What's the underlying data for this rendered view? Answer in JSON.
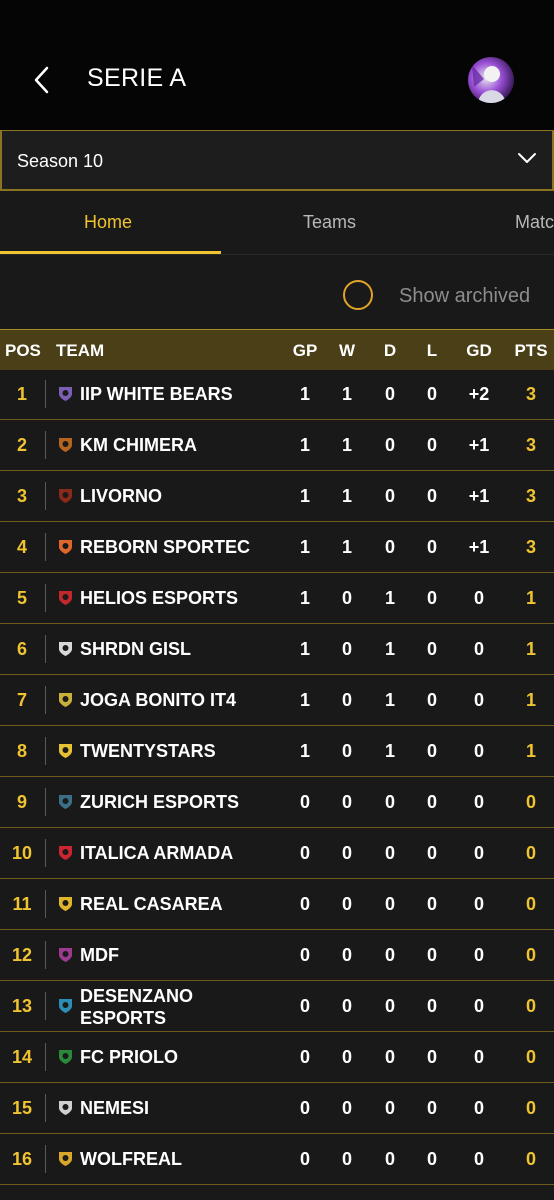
{
  "header": {
    "title": "SERIE A"
  },
  "season": {
    "selected": "Season 10"
  },
  "tabs": [
    {
      "label": "Home",
      "active": true
    },
    {
      "label": "Teams",
      "active": false
    },
    {
      "label": "Matc",
      "active": false
    }
  ],
  "archived": {
    "label": "Show archived",
    "checked": false
  },
  "table": {
    "columns": [
      "POS",
      "TEAM",
      "GP",
      "W",
      "D",
      "L",
      "GD",
      "PTS"
    ],
    "rows": [
      {
        "pos": "1",
        "team": "IIP WHITE BEARS",
        "gp": "1",
        "w": "1",
        "d": "0",
        "l": "0",
        "gd": "+2",
        "pts": "3",
        "logo_color": "#7b5fb4"
      },
      {
        "pos": "2",
        "team": "KM CHIMERA",
        "gp": "1",
        "w": "1",
        "d": "0",
        "l": "0",
        "gd": "+1",
        "pts": "3",
        "logo_color": "#b5651d"
      },
      {
        "pos": "3",
        "team": "LIVORNO",
        "gp": "1",
        "w": "1",
        "d": "0",
        "l": "0",
        "gd": "+1",
        "pts": "3",
        "logo_color": "#8b2a1a"
      },
      {
        "pos": "4",
        "team": "REBORN SPORTEC",
        "gp": "1",
        "w": "1",
        "d": "0",
        "l": "0",
        "gd": "+1",
        "pts": "3",
        "logo_color": "#e0672a"
      },
      {
        "pos": "5",
        "team": "HELIOS ESPORTS",
        "gp": "1",
        "w": "0",
        "d": "1",
        "l": "0",
        "gd": "0",
        "pts": "1",
        "logo_color": "#c0282b"
      },
      {
        "pos": "6",
        "team": "SHRDN GISL",
        "gp": "1",
        "w": "0",
        "d": "1",
        "l": "0",
        "gd": "0",
        "pts": "1",
        "logo_color": "#d8d8d8"
      },
      {
        "pos": "7",
        "team": "JOGA BONITO IT4",
        "gp": "1",
        "w": "0",
        "d": "1",
        "l": "0",
        "gd": "0",
        "pts": "1",
        "logo_color": "#c9b03a"
      },
      {
        "pos": "8",
        "team": "TWENTYSTARS",
        "gp": "1",
        "w": "0",
        "d": "1",
        "l": "0",
        "gd": "0",
        "pts": "1",
        "logo_color": "#e6c234"
      },
      {
        "pos": "9",
        "team": "ZURICH ESPORTS",
        "gp": "0",
        "w": "0",
        "d": "0",
        "l": "0",
        "gd": "0",
        "pts": "0",
        "logo_color": "#3b6f86"
      },
      {
        "pos": "10",
        "team": "ITALICA ARMADA",
        "gp": "0",
        "w": "0",
        "d": "0",
        "l": "0",
        "gd": "0",
        "pts": "0",
        "logo_color": "#cc2530"
      },
      {
        "pos": "11",
        "team": "REAL CASAREA",
        "gp": "0",
        "w": "0",
        "d": "0",
        "l": "0",
        "gd": "0",
        "pts": "0",
        "logo_color": "#e0b52a"
      },
      {
        "pos": "12",
        "team": "MDF",
        "gp": "0",
        "w": "0",
        "d": "0",
        "l": "0",
        "gd": "0",
        "pts": "0",
        "logo_color": "#9b3a8e"
      },
      {
        "pos": "13",
        "team": "DESENZANO ESPORTS",
        "gp": "0",
        "w": "0",
        "d": "0",
        "l": "0",
        "gd": "0",
        "pts": "0",
        "logo_color": "#2b8fb5"
      },
      {
        "pos": "14",
        "team": "FC PRIOLO",
        "gp": "0",
        "w": "0",
        "d": "0",
        "l": "0",
        "gd": "0",
        "pts": "0",
        "logo_color": "#2a8a3a"
      },
      {
        "pos": "15",
        "team": "NEMESI",
        "gp": "0",
        "w": "0",
        "d": "0",
        "l": "0",
        "gd": "0",
        "pts": "0",
        "logo_color": "#d0d0d0"
      },
      {
        "pos": "16",
        "team": "WOLFREAL",
        "gp": "0",
        "w": "0",
        "d": "0",
        "l": "0",
        "gd": "0",
        "pts": "0",
        "logo_color": "#d8a62a"
      }
    ]
  },
  "colors": {
    "accent": "#f0c330",
    "header_bg": "#4b3f17",
    "row_border": "#6f5d1d",
    "background": "#191919"
  },
  "icons": {
    "back": "chevron-left-icon",
    "dropdown": "chevron-down-icon",
    "avatar": "user-avatar"
  }
}
